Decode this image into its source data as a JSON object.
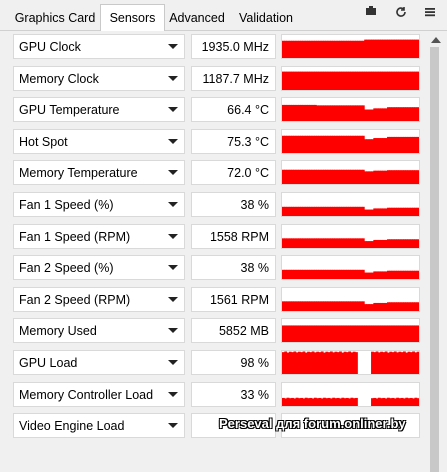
{
  "tabs": [
    {
      "label": "Graphics Card",
      "active": false
    },
    {
      "label": "Sensors",
      "active": true
    },
    {
      "label": "Advanced",
      "active": false
    },
    {
      "label": "Validation",
      "active": false
    }
  ],
  "toolbar_icons": [
    "screenshot-icon",
    "refresh-icon",
    "menu-icon"
  ],
  "graph_color": "#ff0000",
  "sensors": [
    {
      "name": "GPU Clock",
      "value": "1935.0 MHz",
      "level": 0.75,
      "trace": [
        0.75,
        0.75,
        0.75,
        0.75,
        0.75,
        0.75,
        0.75,
        0.75,
        0.75,
        0.75,
        0.75,
        0.75,
        0.75,
        0.75,
        0.75,
        0.75,
        0.75,
        0.75,
        0.75,
        0.75,
        0.75,
        0.75,
        0.75,
        0.75,
        0.75,
        0.75,
        0.75,
        0.75,
        0.75,
        0.75,
        0.75,
        0.75,
        0.75,
        0.75,
        0.75,
        0.75,
        0.8,
        0.8,
        0.8,
        0.8,
        0.8,
        0.8,
        0.8,
        0.8,
        0.8,
        0.8,
        0.8,
        0.8,
        0.8,
        0.8,
        0.8,
        0.8,
        0.8,
        0.8,
        0.8,
        0.8,
        0.8,
        0.8,
        0.8,
        0.8
      ]
    },
    {
      "name": "Memory Clock",
      "value": "1187.7 MHz",
      "level": 0.8,
      "trace": [
        0.8,
        0.8,
        0.8,
        0.8,
        0.8,
        0.8,
        0.8,
        0.8,
        0.8,
        0.8,
        0.8,
        0.8,
        0.8,
        0.8,
        0.8,
        0.8,
        0.8,
        0.8,
        0.8,
        0.8,
        0.8,
        0.8,
        0.8,
        0.8,
        0.8,
        0.8,
        0.8,
        0.8,
        0.8,
        0.8,
        0.8,
        0.8,
        0.8,
        0.8,
        0.8,
        0.8,
        0.8,
        0.8,
        0.8,
        0.8,
        0.8,
        0.8,
        0.8,
        0.8,
        0.8,
        0.8,
        0.8,
        0.8,
        0.8,
        0.8,
        0.8,
        0.8,
        0.8,
        0.8,
        0.8,
        0.8,
        0.8,
        0.8,
        0.8,
        0.8
      ]
    },
    {
      "name": "GPU Temperature",
      "value": "66.4 °C",
      "level": 0.55,
      "trace": [
        0.7,
        0.7,
        0.7,
        0.7,
        0.7,
        0.7,
        0.7,
        0.7,
        0.7,
        0.7,
        0.7,
        0.7,
        0.7,
        0.7,
        0.7,
        0.68,
        0.68,
        0.68,
        0.68,
        0.68,
        0.68,
        0.68,
        0.68,
        0.68,
        0.68,
        0.68,
        0.68,
        0.68,
        0.68,
        0.68,
        0.68,
        0.68,
        0.68,
        0.68,
        0.68,
        0.68,
        0.5,
        0.5,
        0.5,
        0.5,
        0.55,
        0.55,
        0.55,
        0.55,
        0.55,
        0.55,
        0.6,
        0.6,
        0.6,
        0.6,
        0.6,
        0.6,
        0.6,
        0.6,
        0.6,
        0.6,
        0.6,
        0.6,
        0.6,
        0.6
      ]
    },
    {
      "name": "Hot Spot",
      "value": "75.3 °C",
      "level": 0.65,
      "trace": [
        0.75,
        0.75,
        0.75,
        0.75,
        0.75,
        0.75,
        0.75,
        0.75,
        0.75,
        0.75,
        0.75,
        0.75,
        0.75,
        0.75,
        0.75,
        0.75,
        0.75,
        0.75,
        0.75,
        0.75,
        0.75,
        0.75,
        0.75,
        0.75,
        0.75,
        0.75,
        0.75,
        0.75,
        0.75,
        0.75,
        0.75,
        0.75,
        0.75,
        0.75,
        0.75,
        0.75,
        0.6,
        0.6,
        0.6,
        0.6,
        0.65,
        0.65,
        0.65,
        0.65,
        0.65,
        0.65,
        0.7,
        0.7,
        0.7,
        0.7,
        0.7,
        0.7,
        0.7,
        0.7,
        0.7,
        0.7,
        0.7,
        0.7,
        0.7,
        0.7
      ]
    },
    {
      "name": "Memory Temperature",
      "value": "72.0 °C",
      "level": 0.6,
      "trace": [
        0.62,
        0.62,
        0.62,
        0.62,
        0.62,
        0.62,
        0.62,
        0.62,
        0.62,
        0.62,
        0.62,
        0.62,
        0.62,
        0.62,
        0.62,
        0.62,
        0.62,
        0.62,
        0.62,
        0.62,
        0.62,
        0.62,
        0.62,
        0.62,
        0.62,
        0.62,
        0.62,
        0.62,
        0.62,
        0.62,
        0.62,
        0.62,
        0.62,
        0.62,
        0.62,
        0.62,
        0.55,
        0.55,
        0.55,
        0.55,
        0.58,
        0.58,
        0.58,
        0.58,
        0.58,
        0.58,
        0.6,
        0.6,
        0.6,
        0.6,
        0.6,
        0.6,
        0.6,
        0.6,
        0.6,
        0.6,
        0.6,
        0.6,
        0.6,
        0.6
      ]
    },
    {
      "name": "Fan 1 Speed (%)",
      "value": "38 %",
      "level": 0.38,
      "trace": [
        0.4,
        0.4,
        0.4,
        0.4,
        0.4,
        0.4,
        0.4,
        0.4,
        0.4,
        0.4,
        0.4,
        0.4,
        0.4,
        0.4,
        0.4,
        0.4,
        0.4,
        0.4,
        0.4,
        0.4,
        0.4,
        0.4,
        0.4,
        0.4,
        0.4,
        0.4,
        0.4,
        0.4,
        0.4,
        0.4,
        0.4,
        0.4,
        0.4,
        0.4,
        0.4,
        0.4,
        0.28,
        0.28,
        0.28,
        0.28,
        0.33,
        0.33,
        0.33,
        0.33,
        0.33,
        0.33,
        0.36,
        0.36,
        0.36,
        0.36,
        0.36,
        0.36,
        0.36,
        0.36,
        0.36,
        0.36,
        0.36,
        0.36,
        0.36,
        0.36
      ]
    },
    {
      "name": "Fan 1 Speed (RPM)",
      "value": "1558 RPM",
      "level": 0.38,
      "trace": [
        0.42,
        0.42,
        0.42,
        0.42,
        0.42,
        0.42,
        0.42,
        0.42,
        0.42,
        0.42,
        0.42,
        0.42,
        0.42,
        0.42,
        0.42,
        0.42,
        0.42,
        0.42,
        0.42,
        0.42,
        0.42,
        0.42,
        0.42,
        0.42,
        0.42,
        0.42,
        0.42,
        0.42,
        0.42,
        0.42,
        0.42,
        0.42,
        0.42,
        0.42,
        0.42,
        0.42,
        0.3,
        0.3,
        0.3,
        0.3,
        0.35,
        0.35,
        0.35,
        0.35,
        0.35,
        0.35,
        0.38,
        0.38,
        0.38,
        0.38,
        0.38,
        0.38,
        0.38,
        0.38,
        0.38,
        0.38,
        0.38,
        0.38,
        0.38,
        0.38
      ]
    },
    {
      "name": "Fan 2 Speed (%)",
      "value": "38 %",
      "level": 0.38,
      "trace": [
        0.4,
        0.4,
        0.4,
        0.4,
        0.4,
        0.4,
        0.4,
        0.4,
        0.4,
        0.4,
        0.4,
        0.4,
        0.4,
        0.4,
        0.4,
        0.4,
        0.4,
        0.4,
        0.4,
        0.4,
        0.4,
        0.4,
        0.4,
        0.4,
        0.4,
        0.4,
        0.4,
        0.4,
        0.4,
        0.4,
        0.4,
        0.4,
        0.4,
        0.4,
        0.4,
        0.4,
        0.28,
        0.28,
        0.28,
        0.28,
        0.33,
        0.33,
        0.33,
        0.33,
        0.33,
        0.33,
        0.36,
        0.36,
        0.36,
        0.36,
        0.36,
        0.36,
        0.36,
        0.36,
        0.36,
        0.36,
        0.36,
        0.36,
        0.36,
        0.36
      ]
    },
    {
      "name": "Fan 2 Speed (RPM)",
      "value": "1561 RPM",
      "level": 0.38,
      "trace": [
        0.42,
        0.42,
        0.42,
        0.42,
        0.42,
        0.42,
        0.42,
        0.42,
        0.42,
        0.42,
        0.42,
        0.42,
        0.42,
        0.42,
        0.42,
        0.42,
        0.42,
        0.42,
        0.42,
        0.42,
        0.42,
        0.42,
        0.42,
        0.42,
        0.42,
        0.42,
        0.42,
        0.42,
        0.42,
        0.42,
        0.42,
        0.42,
        0.42,
        0.42,
        0.42,
        0.42,
        0.3,
        0.3,
        0.3,
        0.3,
        0.35,
        0.35,
        0.35,
        0.35,
        0.35,
        0.35,
        0.38,
        0.38,
        0.38,
        0.38,
        0.38,
        0.38,
        0.38,
        0.38,
        0.38,
        0.38,
        0.38,
        0.38,
        0.38,
        0.38
      ]
    },
    {
      "name": "Memory Used",
      "value": "5852 MB",
      "level": 0.72,
      "trace": [
        0.72,
        0.72,
        0.72,
        0.72,
        0.72,
        0.72,
        0.72,
        0.72,
        0.72,
        0.72,
        0.72,
        0.72,
        0.72,
        0.72,
        0.72,
        0.72,
        0.72,
        0.72,
        0.72,
        0.72,
        0.72,
        0.72,
        0.72,
        0.72,
        0.72,
        0.72,
        0.72,
        0.72,
        0.72,
        0.72,
        0.72,
        0.72,
        0.72,
        0.72,
        0.72,
        0.72,
        0.72,
        0.72,
        0.72,
        0.72,
        0.72,
        0.72,
        0.72,
        0.72,
        0.72,
        0.72,
        0.72,
        0.72,
        0.72,
        0.72,
        0.72,
        0.72,
        0.72,
        0.72,
        0.72,
        0.72,
        0.72,
        0.72,
        0.72,
        0.72
      ]
    },
    {
      "name": "GPU Load",
      "value": "98 %",
      "level": 0.98,
      "trace": [
        0.95,
        0.98,
        0.93,
        0.97,
        0.95,
        0.98,
        0.94,
        0.97,
        0.95,
        0.98,
        0.93,
        0.97,
        0.95,
        0.98,
        0.94,
        0.97,
        0.95,
        0.98,
        0.93,
        0.97,
        0.95,
        0.98,
        0.94,
        0.97,
        0.95,
        0.98,
        0.93,
        0.97,
        0.95,
        0.98,
        0.94,
        0.97,
        0.95,
        0.0,
        0.0,
        0.0,
        0.0,
        0.0,
        0.0,
        0.97,
        0.95,
        0.98,
        0.94,
        0.97,
        0.95,
        0.98,
        0.93,
        0.97,
        0.95,
        0.98,
        0.94,
        0.97,
        0.95,
        0.98,
        0.93,
        0.97,
        0.95,
        0.98,
        0.94,
        0.97
      ]
    },
    {
      "name": "Memory Controller Load",
      "value": "33 %",
      "level": 0.33,
      "trace": [
        0.35,
        0.33,
        0.36,
        0.34,
        0.35,
        0.33,
        0.36,
        0.34,
        0.35,
        0.33,
        0.36,
        0.34,
        0.35,
        0.33,
        0.36,
        0.34,
        0.35,
        0.33,
        0.36,
        0.34,
        0.35,
        0.33,
        0.36,
        0.34,
        0.35,
        0.33,
        0.36,
        0.34,
        0.35,
        0.33,
        0.36,
        0.34,
        0.35,
        0.0,
        0.0,
        0.0,
        0.0,
        0.0,
        0.0,
        0.34,
        0.35,
        0.33,
        0.36,
        0.34,
        0.35,
        0.33,
        0.36,
        0.34,
        0.35,
        0.33,
        0.36,
        0.34,
        0.35,
        0.33,
        0.36,
        0.34,
        0.35,
        0.33,
        0.36,
        0.34
      ]
    },
    {
      "name": "Video Engine Load",
      "value": "",
      "level": 0.0,
      "trace": []
    }
  ],
  "watermark": "Perseval для forum.onliner.by"
}
